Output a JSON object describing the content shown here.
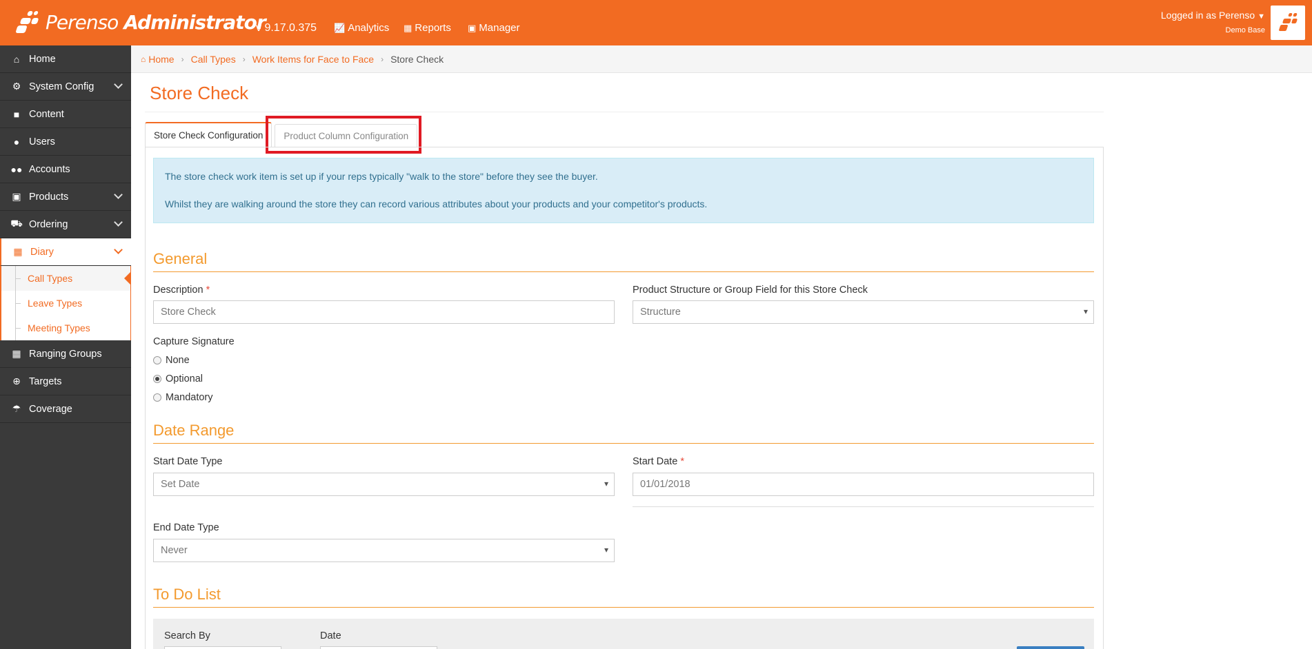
{
  "brand": {
    "name": "Perenso",
    "product": "Administrator",
    "version": "v 9.17.0.375",
    "color": "#f26b22"
  },
  "topnav": [
    {
      "label": "Analytics",
      "icon": "chart-icon"
    },
    {
      "label": "Reports",
      "icon": "table-icon"
    },
    {
      "label": "Manager",
      "icon": "briefcase-icon"
    }
  ],
  "user": {
    "logged_in": "Logged in as Perenso",
    "base": "Demo Base"
  },
  "sidebar": {
    "items": [
      {
        "label": "Home",
        "icon": "home-icon"
      },
      {
        "label": "System Config",
        "icon": "gear-icon"
      },
      {
        "label": "Content",
        "icon": "file-icon"
      },
      {
        "label": "Users",
        "icon": "user-icon"
      },
      {
        "label": "Accounts",
        "icon": "users-icon"
      },
      {
        "label": "Products",
        "icon": "gift-icon"
      },
      {
        "label": "Ordering",
        "icon": "cart-icon"
      },
      {
        "label": "Diary",
        "icon": "calendar-icon"
      },
      {
        "label": "Ranging Groups",
        "icon": "cubes-icon"
      },
      {
        "label": "Targets",
        "icon": "crosshairs-icon"
      },
      {
        "label": "Coverage",
        "icon": "umbrella-icon"
      }
    ],
    "diary_sub": [
      {
        "label": "Call Types"
      },
      {
        "label": "Leave Types"
      },
      {
        "label": "Meeting Types"
      }
    ]
  },
  "breadcrumb": {
    "home": "Home",
    "crumb1": "Call Types",
    "crumb2": "Work Items for Face to Face",
    "current": "Store Check"
  },
  "page": {
    "title": "Store Check",
    "tabs": [
      "Store Check Configuration",
      "Product Column Configuration"
    ],
    "info_line1": "The store check work item is set up if your reps typically \"walk to the store\" before they see the buyer.",
    "info_line2": "Whilst they are walking around the store they can record various attributes about your products and your competitor's products."
  },
  "general": {
    "heading": "General",
    "description_label": "Description",
    "description_value": "Store Check",
    "structure_label": "Product Structure or Group Field for this Store Check",
    "structure_value": "Structure",
    "signature_label": "Capture Signature",
    "signature_options": [
      "None",
      "Optional",
      "Mandatory"
    ],
    "signature_selected": "Optional"
  },
  "date_range": {
    "heading": "Date Range",
    "start_type_label": "Start Date Type",
    "start_type_value": "Set Date",
    "start_date_label": "Start Date",
    "start_date_value": "01/01/2018",
    "end_type_label": "End Date Type",
    "end_type_value": "Never"
  },
  "todo": {
    "heading": "To Do List",
    "search_by_label": "Search By",
    "date_label": "Date"
  },
  "required_mark": "*"
}
